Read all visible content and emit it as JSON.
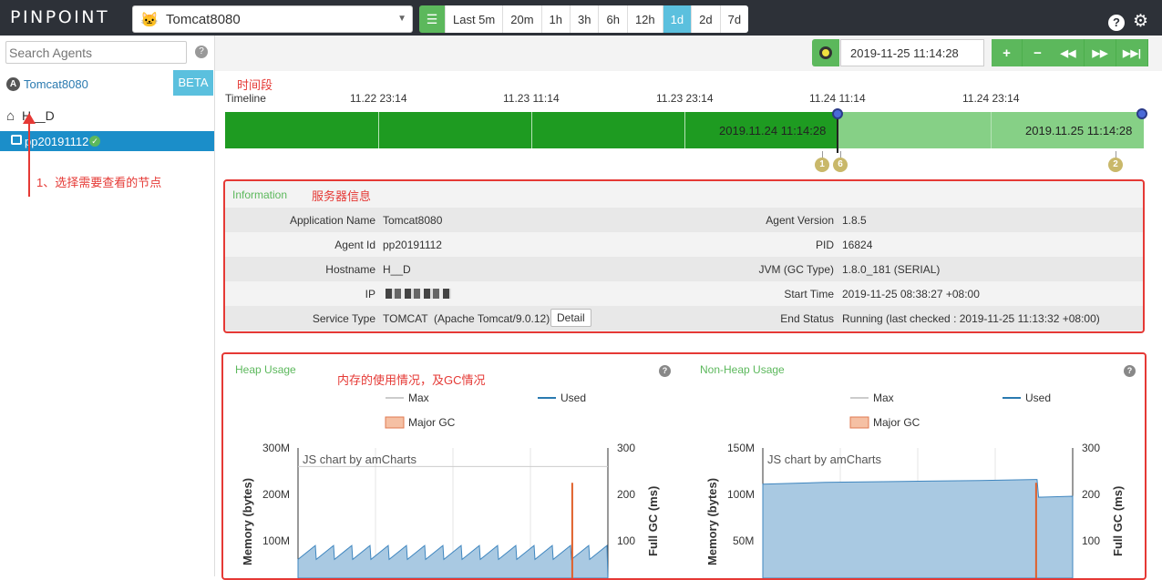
{
  "header": {
    "logo": "PINPOINT",
    "app_name": "Tomcat8080",
    "ranges": [
      "Last 5m",
      "20m",
      "1h",
      "3h",
      "6h",
      "12h",
      "1d",
      "2d",
      "7d"
    ],
    "active_range": "1d",
    "help": "?"
  },
  "sidebar": {
    "search_placeholder": "Search Agents",
    "app_badge": "A",
    "app_name": "Tomcat8080",
    "beta": "BETA",
    "host": "H__D",
    "agent": "pp20191112",
    "annotation": "1、选择需要查看的节点"
  },
  "toolbar": {
    "datetime": "2019-11-25 11:14:28",
    "zoom_in": "+",
    "zoom_out": "−"
  },
  "timeline": {
    "annotation": "时间段",
    "label": "Timeline",
    "ticks": [
      "11.22 23:14",
      "11.23 11:14",
      "11.23 23:14",
      "11.24 11:14",
      "11.24 23:14"
    ],
    "date1": "2019.11.24 11:14:28",
    "date2": "2019.11.25 11:14:28",
    "events": [
      "1",
      "6",
      "2"
    ]
  },
  "info": {
    "title": "Information",
    "annotation": "服务器信息",
    "left": [
      {
        "label": "Application Name",
        "value": "Tomcat8080"
      },
      {
        "label": "Agent Id",
        "value": "pp20191112"
      },
      {
        "label": "Hostname",
        "value": "H__D"
      },
      {
        "label": "IP",
        "value": ""
      },
      {
        "label": "Service Type",
        "value": "TOMCAT  (Apache Tomcat/9.0.12)"
      }
    ],
    "right": [
      {
        "label": "Agent Version",
        "value": "1.8.5"
      },
      {
        "label": "PID",
        "value": "16824"
      },
      {
        "label": "JVM (GC Type)",
        "value": "1.8.0_181 (SERIAL)"
      },
      {
        "label": "Start Time",
        "value": "2019-11-25 08:38:27 +08:00"
      },
      {
        "label": "End Status",
        "value": "Running (last checked : 2019-11-25 11:13:32 +08:00)"
      }
    ],
    "detail_button": "Detail"
  },
  "charts": {
    "annotation": "内存的使用情况，及GC情况",
    "heap": {
      "title": "Heap Usage",
      "legend_max": "Max",
      "legend_used": "Used",
      "legend_gc": "Major GC",
      "watermark": "JS chart by amCharts",
      "ylabel_left": "Memory (bytes)",
      "ylabel_right": "Full GC (ms)",
      "left_ticks": [
        "300M",
        "200M",
        "100M"
      ],
      "right_ticks": [
        "300",
        "200",
        "100"
      ]
    },
    "nonheap": {
      "title": "Non-Heap Usage",
      "legend_max": "Max",
      "legend_used": "Used",
      "legend_gc": "Major GC",
      "watermark": "JS chart by amCharts",
      "ylabel_left": "Memory (bytes)",
      "ylabel_right": "Full GC (ms)",
      "left_ticks": [
        "150M",
        "100M",
        "50M"
      ],
      "right_ticks": [
        "300",
        "200",
        "100"
      ]
    }
  },
  "chart_data": [
    {
      "type": "area",
      "title": "Heap Usage",
      "ylabel": "Memory (bytes)",
      "ylim_left_M": [
        0,
        300
      ],
      "ylim_right_ms": [
        0,
        300
      ],
      "series": [
        {
          "name": "Max",
          "values_M": [
            260,
            260
          ]
        },
        {
          "name": "Used",
          "sawtooth_range_M": [
            60,
            90
          ]
        },
        {
          "name": "Major GC",
          "spike_ms": 225
        }
      ]
    },
    {
      "type": "area",
      "title": "Non-Heap Usage",
      "ylabel": "Memory (bytes)",
      "ylim_left_M": [
        0,
        150
      ],
      "ylim_right_ms": [
        0,
        300
      ],
      "series": [
        {
          "name": "Used",
          "values_M": [
            111,
            113,
            114,
            115,
            116,
            116,
            97,
            98
          ]
        },
        {
          "name": "Major GC",
          "spike_ms": 225
        }
      ]
    }
  ]
}
